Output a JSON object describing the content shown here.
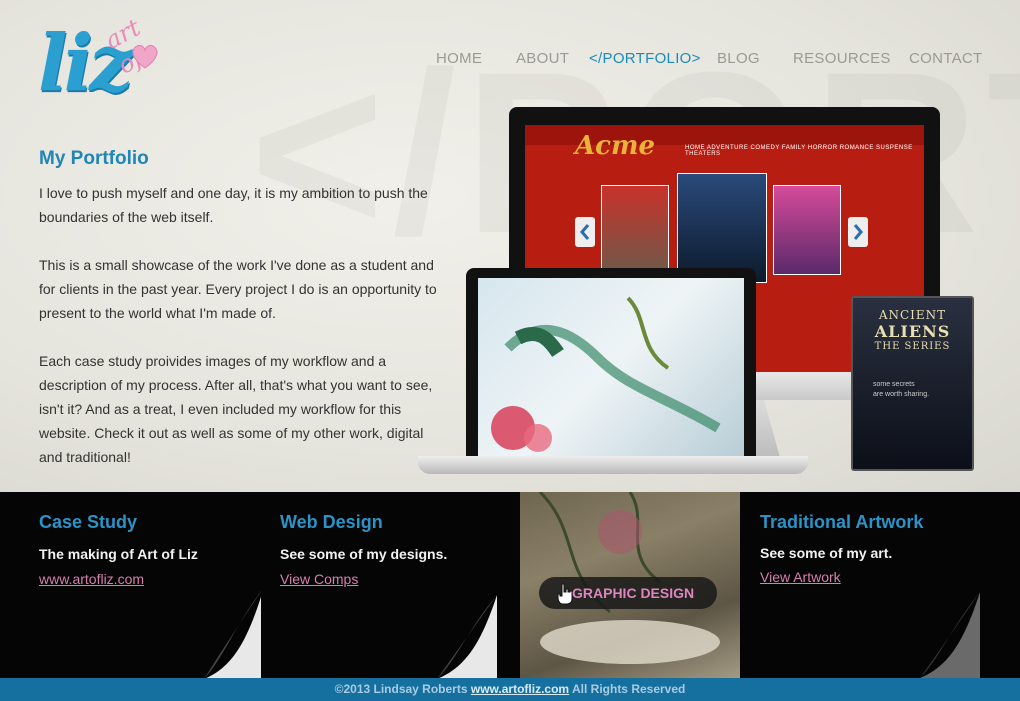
{
  "brand": {
    "logo_main": "liz",
    "logo_sub": "art of"
  },
  "nav": {
    "items": [
      {
        "label": "HOME"
      },
      {
        "label": "ABOUT"
      },
      {
        "label": "</PORTFOLIO>"
      },
      {
        "label": "BLOG"
      },
      {
        "label": "RESOURCES"
      },
      {
        "label": "CONTACT"
      }
    ],
    "active": "</PORTFOLIO>"
  },
  "hero": {
    "watermark": "</PORT",
    "title": "My Portfolio",
    "paragraphs": [
      "I love to push myself and one day, it is my ambition to push the boundaries of the web itself.",
      "This is a small showcase of the work I've done as a student and for clients in the past year. Every project I do is an opportunity to present to the world what I'm made of.",
      "Each case study proivides images of my workflow and a description of my process. After all, that's what you want to see, isn't it? And as a treat, I even included my workflow for this website. Check it out as well as some of my other work, digital and traditional!"
    ]
  },
  "devices": {
    "imac_brand": "Acme",
    "imac_menu": "HOME  ADVENTURE  COMEDY  FAMILY  HORROR  ROMANCE  SUSPENSE  THEATERS",
    "dvd_line1": "ANCIENT",
    "dvd_line2": "ALIENS",
    "dvd_line3": "THE SERIES",
    "dvd_tagline": "some secrets\nare worth sharing."
  },
  "cards": [
    {
      "title": "Case Study",
      "desc": "The making of Art of Liz",
      "link": "www.artofliz.com"
    },
    {
      "title": "Web Design",
      "desc": "See some of my designs.",
      "link": "View Comps"
    },
    {
      "title": "Traditional Artwork",
      "desc": "See some of my art.",
      "link": "View Artwork"
    }
  ],
  "graphic_design": {
    "label": "GRAPHIC DESIGN"
  },
  "footer": {
    "prefix": "©2013 Lindsay Roberts",
    "link": "www.artofliz.com",
    "suffix": "All Rights Reserved"
  },
  "colors": {
    "accent": "#1f86b8",
    "pink": "#d67fb0",
    "footer_bg": "#1570a0",
    "band_bg": "#050505"
  }
}
